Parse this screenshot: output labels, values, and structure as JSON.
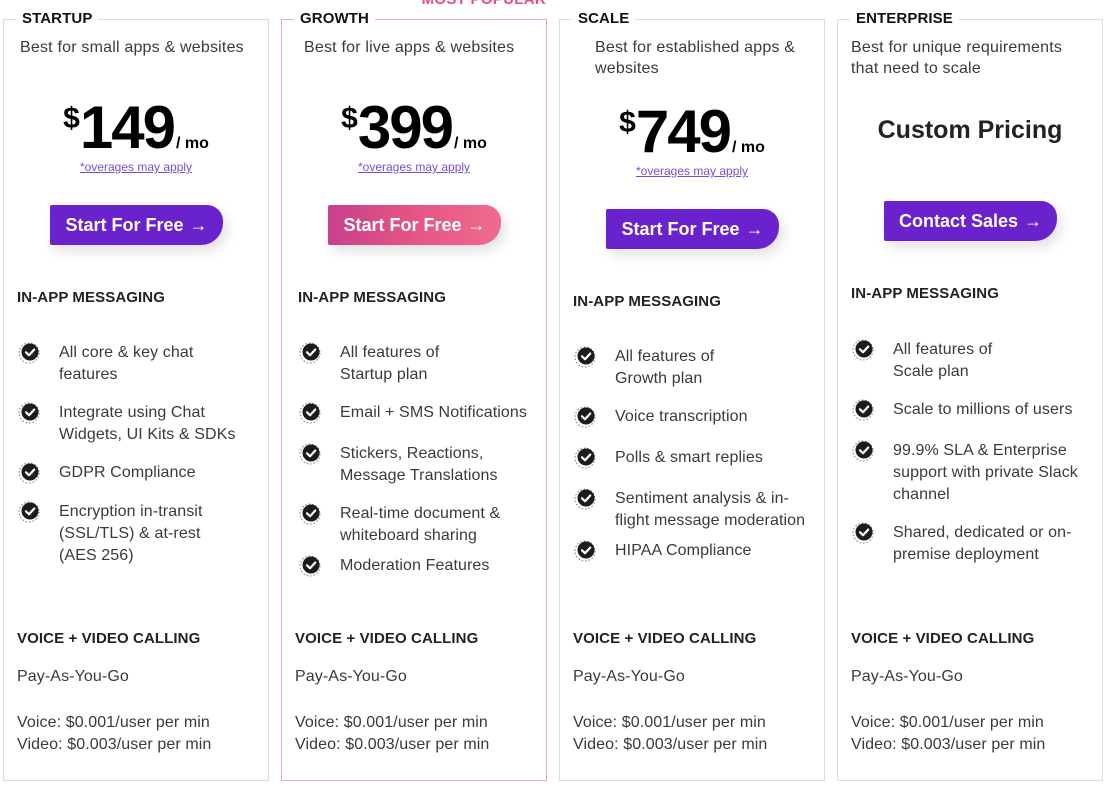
{
  "plans": [
    {
      "name": "STARTUP",
      "tagline": "Best for small apps & websites",
      "currency": "$",
      "price": "149",
      "period": "/ mo",
      "overages": "*overages may apply",
      "cta": "Start For Free",
      "cta_arrow": "→",
      "messaging_title": "IN-APP MESSAGING",
      "features": [
        "All core & key chat features",
        "Integrate using Chat Widgets, UI Kits & SDKs",
        "GDPR Compliance",
        "Encryption in-transit (SSL/TLS) & at-rest (AES 256)"
      ],
      "calling_title": "VOICE + VIDEO CALLING",
      "calling_model": "Pay-As-You-Go",
      "voice_rate": "Voice: $0.001/user per min",
      "video_rate": "Video: $0.003/user per min"
    },
    {
      "name": "GROWTH",
      "badge": "MOST POPULAR",
      "tagline": "Best for live apps & websites",
      "currency": "$",
      "price": "399",
      "period": "/ mo",
      "overages": "*overages may apply",
      "cta": "Start For Free",
      "cta_arrow": "→",
      "messaging_title": "IN-APP MESSAGING",
      "features": [
        "All features of Startup plan",
        "Email + SMS Notifications",
        "Stickers, Reactions, Message Translations",
        "Real-time document & whiteboard sharing",
        "Moderation Features"
      ],
      "calling_title": "VOICE + VIDEO CALLING",
      "calling_model": "Pay-As-You-Go",
      "voice_rate": "Voice: $0.001/user per min",
      "video_rate": "Video: $0.003/user per min"
    },
    {
      "name": "SCALE",
      "tagline": "Best for established apps & websites",
      "currency": "$",
      "price": "749",
      "period": "/ mo",
      "overages": "*overages may apply",
      "cta": "Start For Free",
      "cta_arrow": "→",
      "messaging_title": "IN-APP MESSAGING",
      "features": [
        "All features of Growth plan",
        "Voice transcription",
        "Polls & smart replies",
        "Sentiment analysis & in-flight message moderation",
        "HIPAA Compliance"
      ],
      "calling_title": "VOICE + VIDEO CALLING",
      "calling_model": "Pay-As-You-Go",
      "voice_rate": "Voice: $0.001/user per min",
      "video_rate": "Video: $0.003/user per min"
    },
    {
      "name": "ENTERPRISE",
      "tagline": "Best for unique requirements that need to scale",
      "custom_price": "Custom Pricing",
      "cta": "Contact Sales",
      "cta_arrow": "→",
      "messaging_title": "IN-APP MESSAGING",
      "features": [
        "All features of Scale plan",
        "Scale to millions of users",
        "99.9% SLA & Enterprise support with private Slack channel",
        "Shared, dedicated or on-premise deployment"
      ],
      "calling_title": "VOICE + VIDEO CALLING",
      "calling_model": "Pay-As-You-Go",
      "voice_rate": "Voice: $0.001/user per min",
      "video_rate": "Video: $0.003/user per min"
    }
  ],
  "colors": {
    "primary": "#6a22cc",
    "popular": "#ec4b82",
    "popular_border": "#f4a3b4",
    "link": "#7b4bd8"
  }
}
